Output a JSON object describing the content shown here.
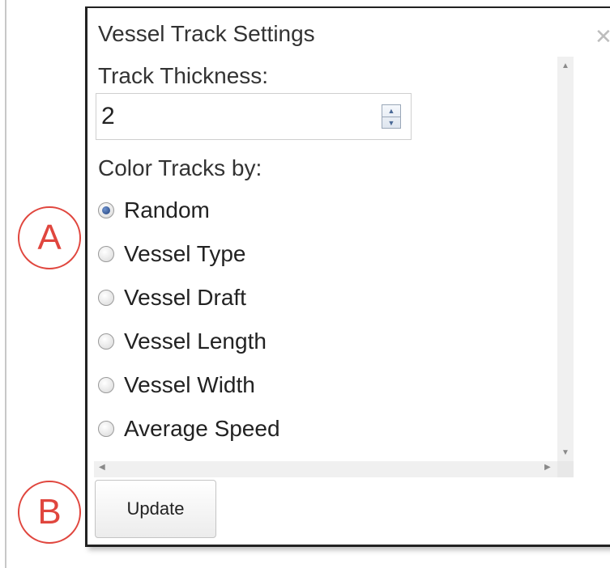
{
  "dialog": {
    "title": "Vessel Track Settings",
    "close_icon": "close-icon"
  },
  "track_thickness": {
    "label": "Track Thickness:",
    "value": "2"
  },
  "color_tracks": {
    "label": "Color Tracks by:",
    "selected": "Random",
    "options": [
      {
        "label": "Random",
        "checked": true
      },
      {
        "label": "Vessel Type",
        "checked": false
      },
      {
        "label": "Vessel Draft",
        "checked": false
      },
      {
        "label": "Vessel Length",
        "checked": false
      },
      {
        "label": "Vessel Width",
        "checked": false
      },
      {
        "label": "Average Speed",
        "checked": false
      }
    ]
  },
  "update_button": {
    "label": "Update"
  },
  "callouts": {
    "a": "A",
    "b": "B"
  },
  "colors": {
    "callout": "#e0463e",
    "radio_selected": "#1f3f7a",
    "panel_border": "#222222"
  }
}
